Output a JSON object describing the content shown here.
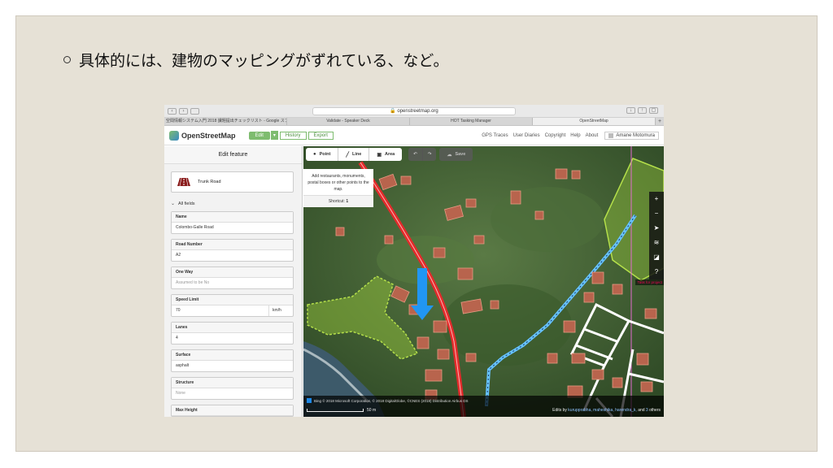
{
  "slide": {
    "bullet_text": "具体的には、建物のマッピングがずれている、など。"
  },
  "browser": {
    "url": "openstreetmap.org",
    "tabs": [
      "空間情報システム入門 2018 課題提出チェックリスト - Google スプ",
      "Validate - Speaker Deck",
      "HOT Tasking Manager",
      "OpenStreetMap"
    ],
    "active_tab": 3
  },
  "osm_header": {
    "brand": "OpenStreetMap",
    "edit_label": "Edit",
    "dropdown_glyph": "▾",
    "history_label": "History",
    "export_label": "Export",
    "nav_links": [
      "GPS Traces",
      "User Diaries",
      "Copyright",
      "Help",
      "About"
    ],
    "user_name": "Amane Motomura"
  },
  "sidebar": {
    "title": "Edit feature",
    "preset_label": "Trunk Road",
    "all_fields_label": "All fields",
    "fields": [
      {
        "label": "Name",
        "value": "Colombo-Galle Road",
        "placeholder": false
      },
      {
        "label": "Road Number",
        "value": "A2",
        "placeholder": false
      },
      {
        "label": "One Way",
        "value": "Assumed to be No",
        "placeholder": true
      },
      {
        "label": "Speed Limit",
        "value": "70",
        "unit": "km/h",
        "placeholder": false
      },
      {
        "label": "Lanes",
        "value": "4",
        "placeholder": false
      },
      {
        "label": "Surface",
        "value": "asphalt",
        "placeholder": false
      },
      {
        "label": "Structure",
        "value": "None",
        "placeholder": true
      },
      {
        "label": "Max Height",
        "value": "",
        "placeholder": false
      }
    ]
  },
  "map": {
    "tools": {
      "point": "Point",
      "line": "Line",
      "area": "Area",
      "save": "Save"
    },
    "tooltip": {
      "body": "Add restaurants, monuments, postal boxes or other points to the map.",
      "shortcut_label": "Shortcut:",
      "shortcut_key": "1"
    },
    "controls": [
      "+",
      "−",
      "➤",
      "≋",
      "◪",
      "?"
    ],
    "task_label": "Task for project",
    "attribution": "Bing   © 2018 Microsoft Corporation, © 2018 DigitalGlobe, ©CNES (2018) Distribution Airbus DS",
    "scale_label": "50 m",
    "edits": {
      "prefix": "Edits by",
      "users": "kurupprabha, maheshika, harendra_k,",
      "and": "and",
      "count": "3",
      "suffix": "others"
    },
    "colors": {
      "road": "#e22b2b",
      "arrow": "#2196f3",
      "area": "#9ccc3c",
      "buildings": "#b8644d",
      "footways": "#ffffff"
    }
  }
}
